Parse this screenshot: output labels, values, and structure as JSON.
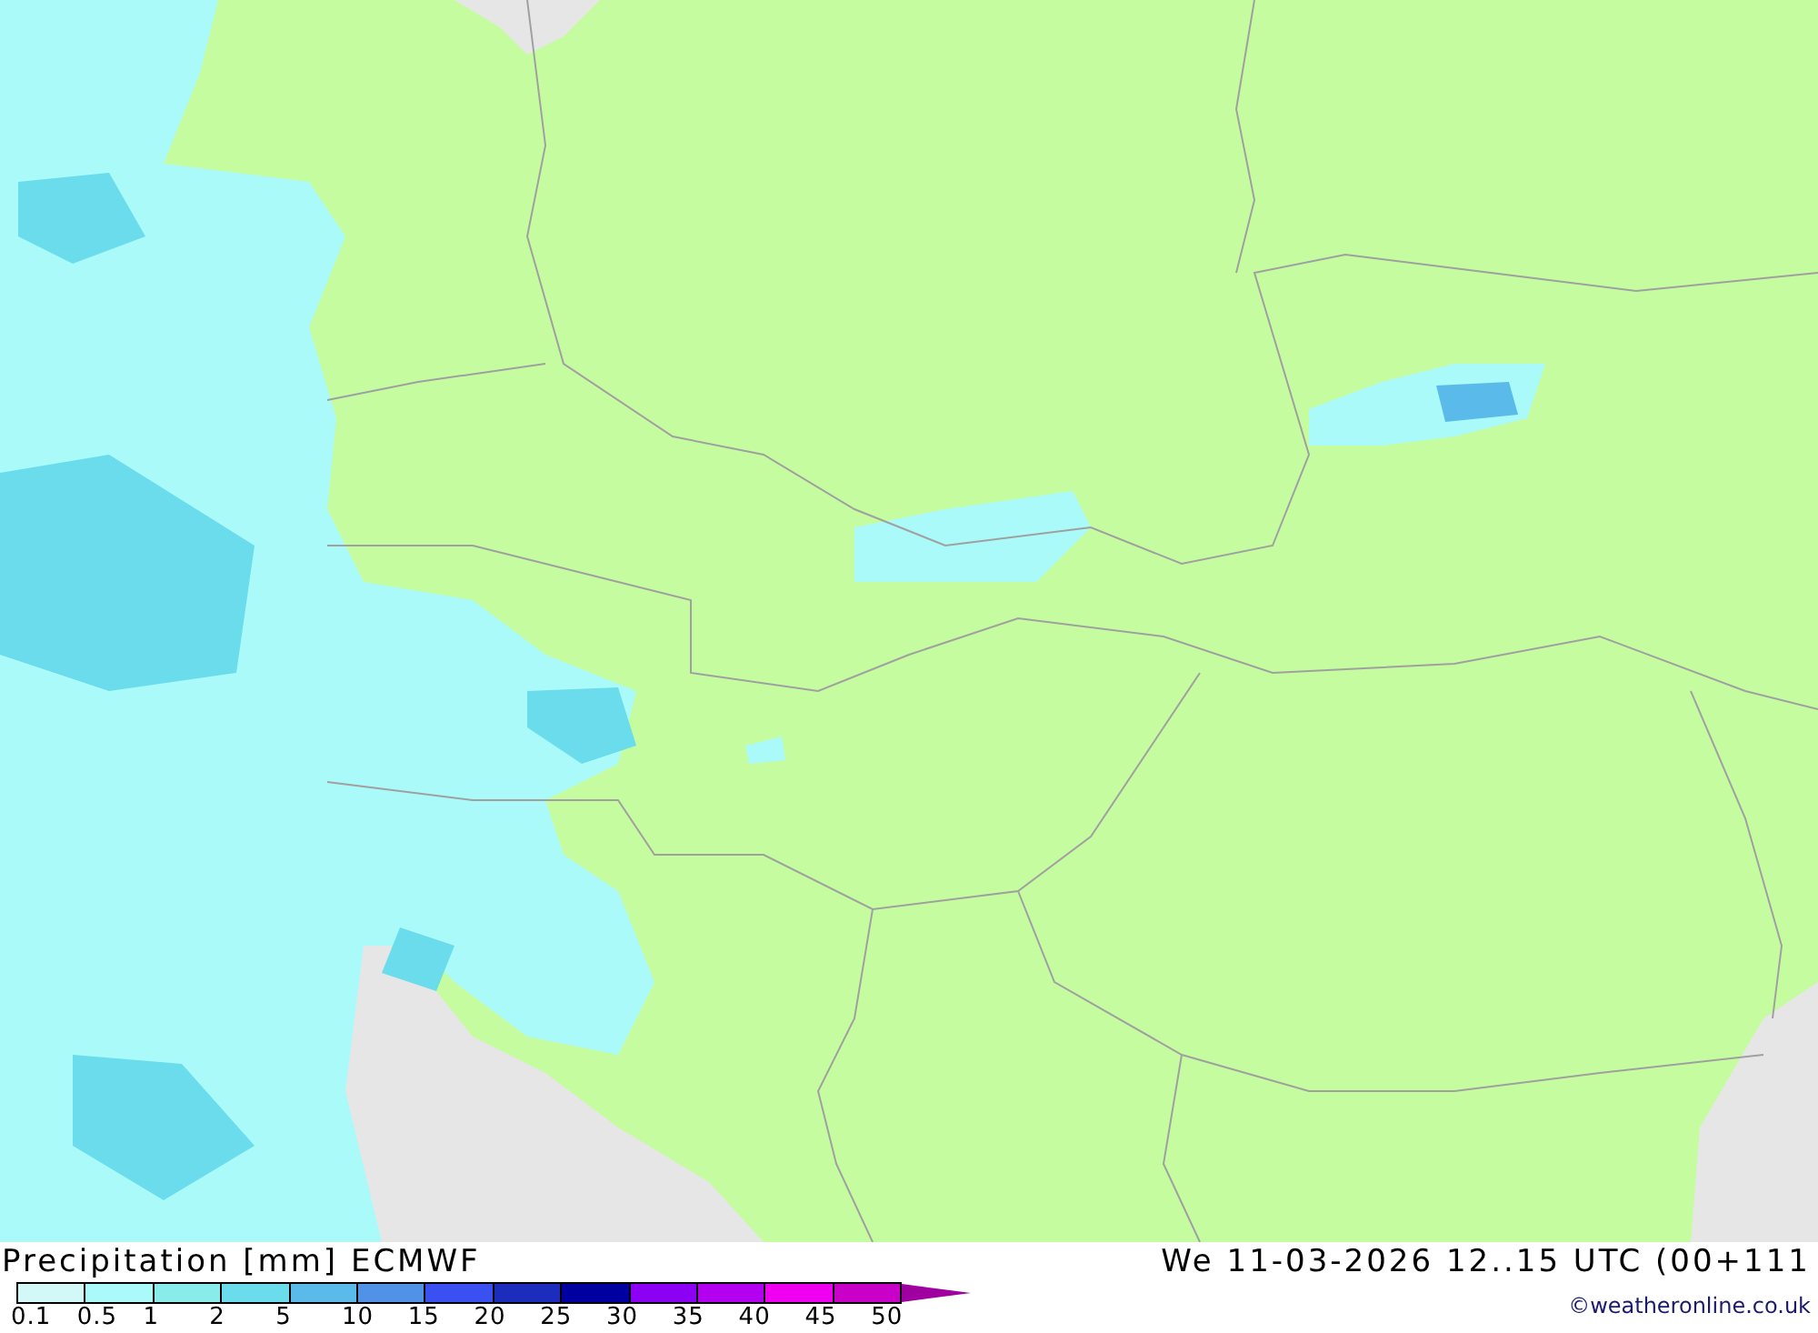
{
  "title": "Precipitation [mm] ECMWF",
  "valid_time": "We 11-03-2026 12..15 UTC (00+111",
  "credit": "©weatheronline.co.uk",
  "legend": {
    "bins": [
      {
        "color": "#d2f8f8"
      },
      {
        "color": "#aafafa"
      },
      {
        "color": "#88eceb"
      },
      {
        "color": "#6adcec"
      },
      {
        "color": "#5abaea"
      },
      {
        "color": "#4f92e6"
      },
      {
        "color": "#3a50f0"
      },
      {
        "color": "#1c2cbc"
      },
      {
        "color": "#0000a0"
      },
      {
        "color": "#8c00f4"
      },
      {
        "color": "#b400f0"
      },
      {
        "color": "#f000f0"
      },
      {
        "color": "#c800c8"
      }
    ],
    "arrow": {
      "color": "#a000a0"
    },
    "labels": [
      "0.1",
      "0.5",
      "1",
      "2",
      "5",
      "10",
      "15",
      "20",
      "25",
      "30",
      "35",
      "40",
      "45",
      "50"
    ]
  }
}
